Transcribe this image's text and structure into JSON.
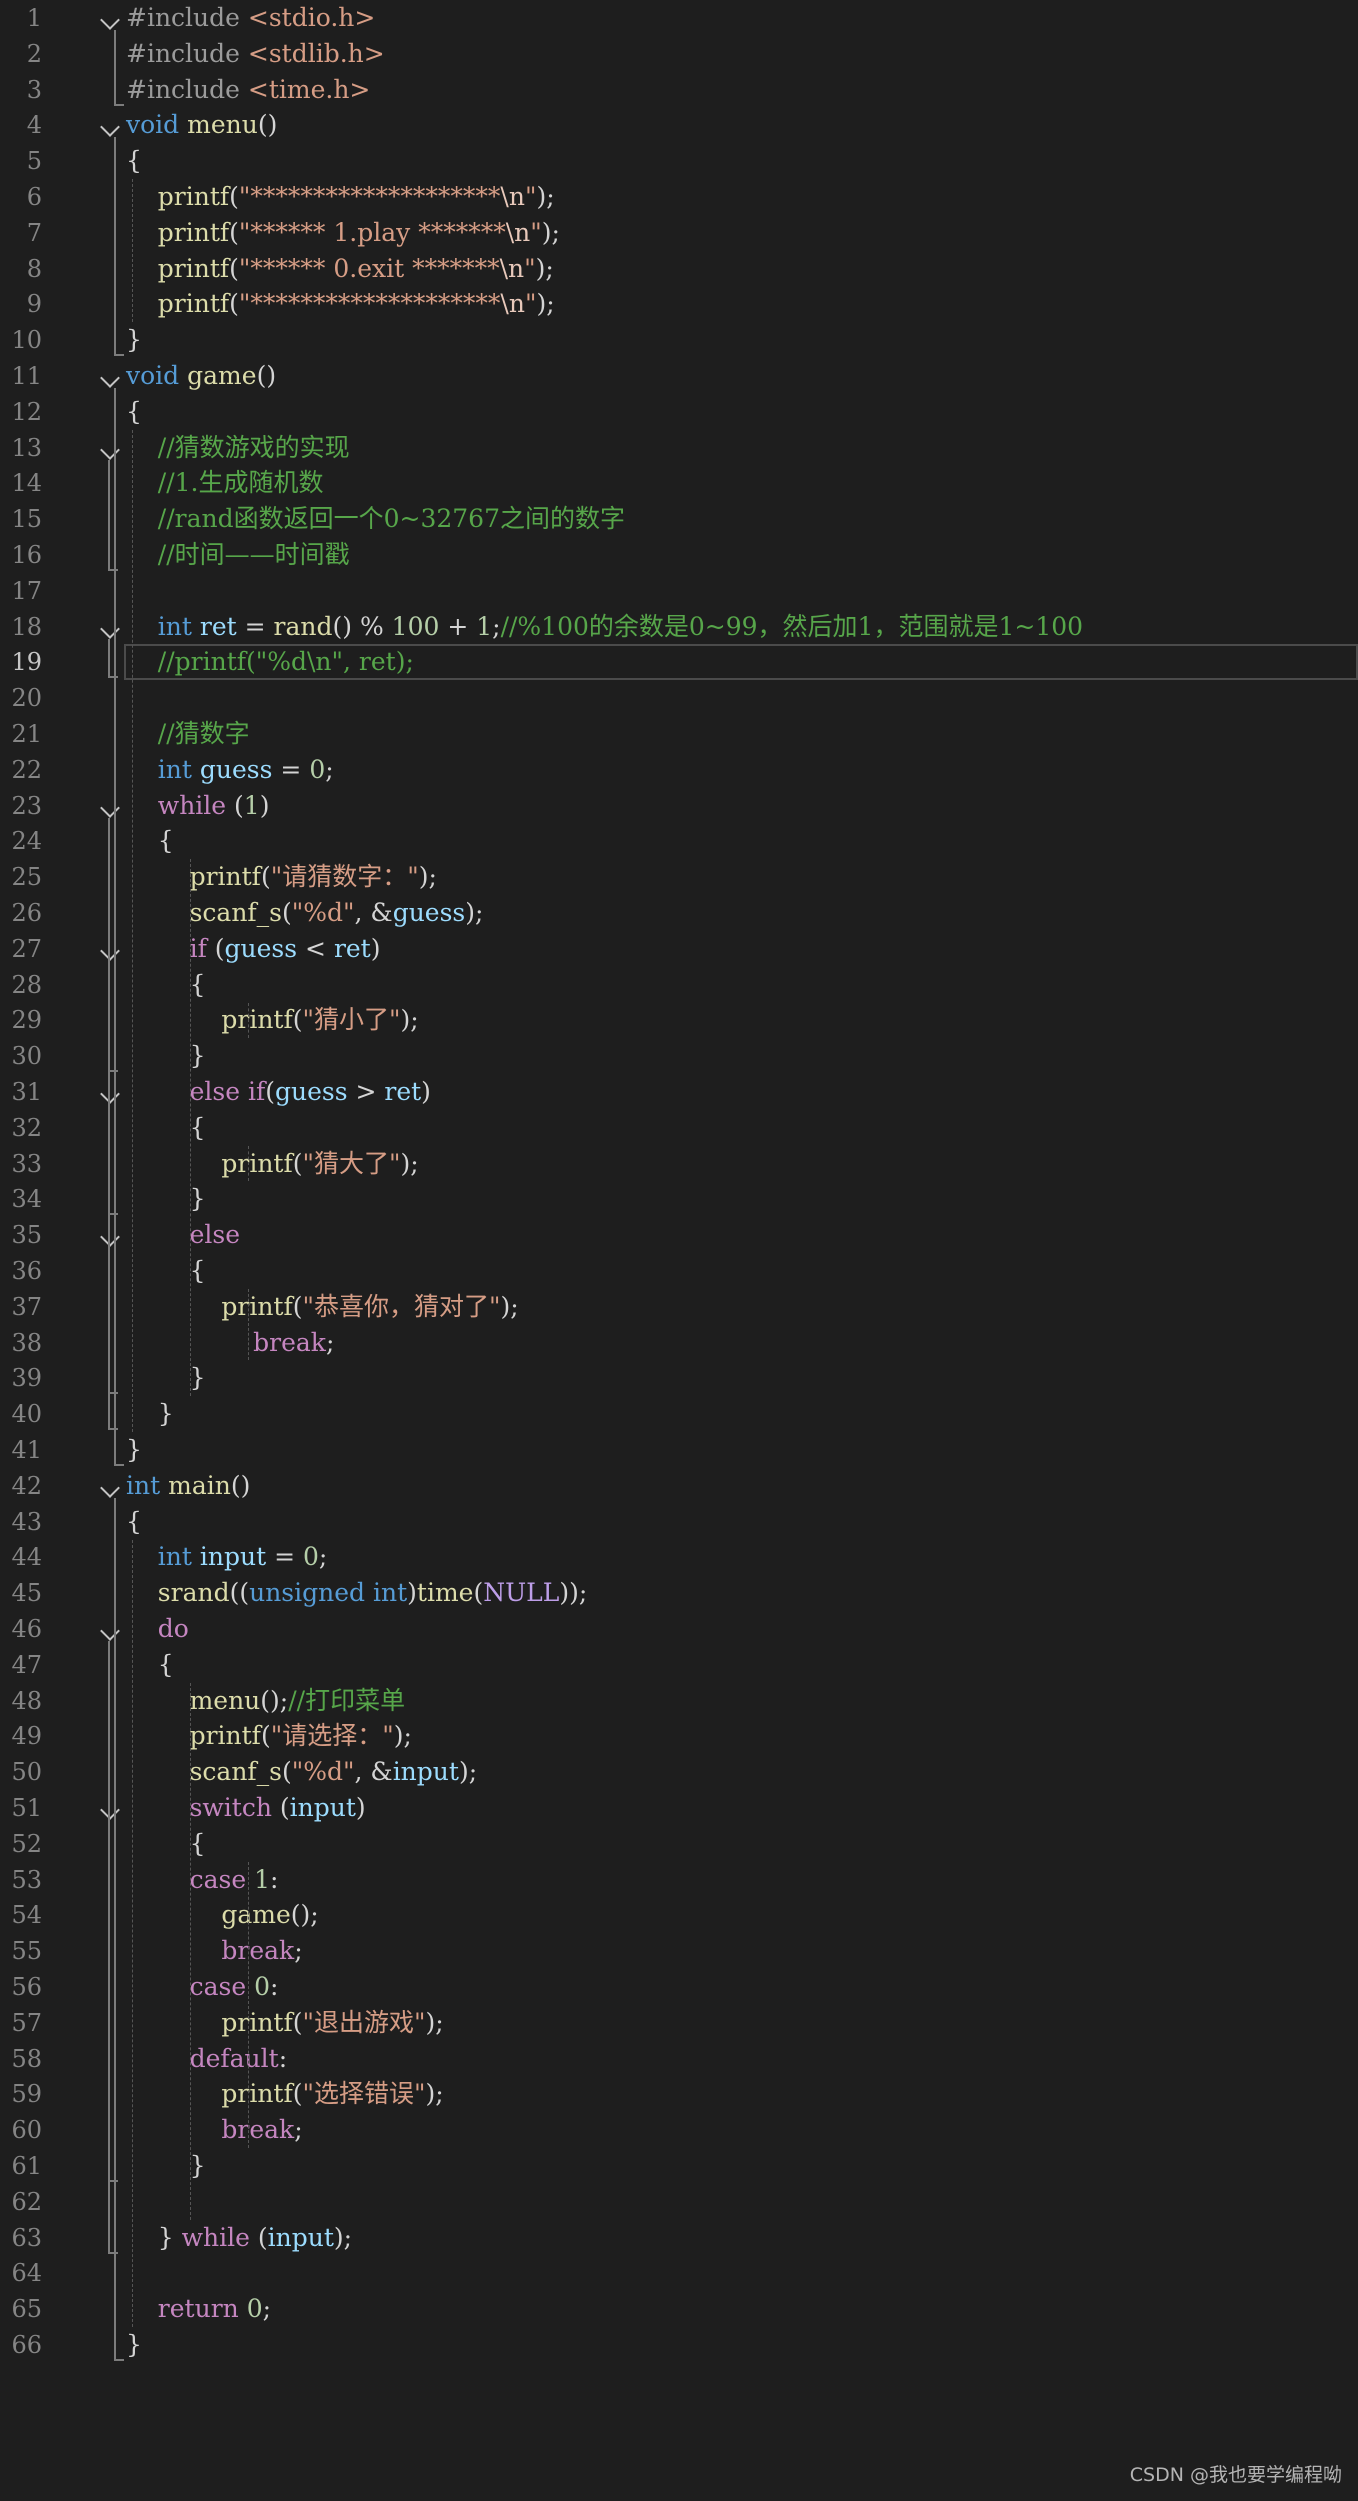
{
  "editor": {
    "current_line": 19,
    "folded_lines": [
      1,
      4,
      11,
      13,
      18,
      23,
      27,
      31,
      35,
      42,
      46,
      51
    ],
    "lines": [
      {
        "n": "1",
        "tokens": [
          [
            "pp",
            "#include "
          ],
          [
            "inc",
            "<stdio.h>"
          ]
        ]
      },
      {
        "n": "2",
        "tokens": [
          [
            "pp",
            "#include "
          ],
          [
            "inc",
            "<stdlib.h>"
          ]
        ]
      },
      {
        "n": "3",
        "tokens": [
          [
            "pp",
            "#include "
          ],
          [
            "inc",
            "<time.h>"
          ]
        ]
      },
      {
        "n": "4",
        "tokens": [
          [
            "kw",
            "void"
          ],
          [
            "pl",
            " "
          ],
          [
            "fn",
            "menu"
          ],
          [
            "pl",
            "()"
          ]
        ]
      },
      {
        "n": "5",
        "tokens": [
          [
            "pl",
            "{"
          ]
        ]
      },
      {
        "n": "6",
        "tokens": [
          [
            "pl",
            "    "
          ],
          [
            "fn",
            "printf"
          ],
          [
            "pl",
            "("
          ],
          [
            "str",
            "\"********************"
          ],
          [
            "esc",
            "\\n"
          ],
          [
            "str",
            "\""
          ],
          [
            "pl",
            ");"
          ]
        ]
      },
      {
        "n": "7",
        "tokens": [
          [
            "pl",
            "    "
          ],
          [
            "fn",
            "printf"
          ],
          [
            "pl",
            "("
          ],
          [
            "str",
            "\"****** 1.play *******"
          ],
          [
            "esc",
            "\\n"
          ],
          [
            "str",
            "\""
          ],
          [
            "pl",
            ");"
          ]
        ]
      },
      {
        "n": "8",
        "tokens": [
          [
            "pl",
            "    "
          ],
          [
            "fn",
            "printf"
          ],
          [
            "pl",
            "("
          ],
          [
            "str",
            "\"****** 0.exit *******"
          ],
          [
            "esc",
            "\\n"
          ],
          [
            "str",
            "\""
          ],
          [
            "pl",
            ");"
          ]
        ]
      },
      {
        "n": "9",
        "tokens": [
          [
            "pl",
            "    "
          ],
          [
            "fn",
            "printf"
          ],
          [
            "pl",
            "("
          ],
          [
            "str",
            "\"********************"
          ],
          [
            "esc",
            "\\n"
          ],
          [
            "str",
            "\""
          ],
          [
            "pl",
            ");"
          ]
        ]
      },
      {
        "n": "10",
        "tokens": [
          [
            "pl",
            "}"
          ]
        ]
      },
      {
        "n": "11",
        "tokens": [
          [
            "kw",
            "void"
          ],
          [
            "pl",
            " "
          ],
          [
            "fn",
            "game"
          ],
          [
            "pl",
            "()"
          ]
        ]
      },
      {
        "n": "12",
        "tokens": [
          [
            "pl",
            "{"
          ]
        ]
      },
      {
        "n": "13",
        "tokens": [
          [
            "pl",
            "    "
          ],
          [
            "com",
            "//猜数游戏的实现"
          ]
        ]
      },
      {
        "n": "14",
        "tokens": [
          [
            "pl",
            "    "
          ],
          [
            "com",
            "//1.生成随机数"
          ]
        ]
      },
      {
        "n": "15",
        "tokens": [
          [
            "pl",
            "    "
          ],
          [
            "com",
            "//rand函数返回一个0~32767之间的数字"
          ]
        ]
      },
      {
        "n": "16",
        "tokens": [
          [
            "pl",
            "    "
          ],
          [
            "com",
            "//时间——时间戳"
          ]
        ]
      },
      {
        "n": "17",
        "tokens": []
      },
      {
        "n": "18",
        "tokens": [
          [
            "pl",
            "    "
          ],
          [
            "kw",
            "int"
          ],
          [
            "pl",
            " "
          ],
          [
            "var",
            "ret"
          ],
          [
            "pl",
            " = "
          ],
          [
            "fn",
            "rand"
          ],
          [
            "pl",
            "() % "
          ],
          [
            "num",
            "100"
          ],
          [
            "pl",
            " + "
          ],
          [
            "num",
            "1"
          ],
          [
            "pl",
            ";"
          ],
          [
            "com",
            "//%100的余数是0~99，然后加1，范围就是1~100"
          ]
        ]
      },
      {
        "n": "19",
        "tokens": [
          [
            "pl",
            "    "
          ],
          [
            "com",
            "//printf(\"%d\\n\", ret);"
          ]
        ]
      },
      {
        "n": "20",
        "tokens": []
      },
      {
        "n": "21",
        "tokens": [
          [
            "pl",
            "    "
          ],
          [
            "com",
            "//猜数字"
          ]
        ]
      },
      {
        "n": "22",
        "tokens": [
          [
            "pl",
            "    "
          ],
          [
            "kw",
            "int"
          ],
          [
            "pl",
            " "
          ],
          [
            "var",
            "guess"
          ],
          [
            "pl",
            " = "
          ],
          [
            "num",
            "0"
          ],
          [
            "pl",
            ";"
          ]
        ]
      },
      {
        "n": "23",
        "tokens": [
          [
            "pl",
            "    "
          ],
          [
            "ctl",
            "while"
          ],
          [
            "pl",
            " ("
          ],
          [
            "num",
            "1"
          ],
          [
            "pl",
            ")"
          ]
        ]
      },
      {
        "n": "24",
        "tokens": [
          [
            "pl",
            "    {"
          ]
        ]
      },
      {
        "n": "25",
        "tokens": [
          [
            "pl",
            "        "
          ],
          [
            "fn",
            "printf"
          ],
          [
            "pl",
            "("
          ],
          [
            "str",
            "\"请猜数字：\""
          ],
          [
            "pl",
            ");"
          ]
        ]
      },
      {
        "n": "26",
        "tokens": [
          [
            "pl",
            "        "
          ],
          [
            "fn",
            "scanf_s"
          ],
          [
            "pl",
            "("
          ],
          [
            "str",
            "\"%d\""
          ],
          [
            "pl",
            ", &"
          ],
          [
            "var",
            "guess"
          ],
          [
            "pl",
            ");"
          ]
        ]
      },
      {
        "n": "27",
        "tokens": [
          [
            "pl",
            "        "
          ],
          [
            "ctl",
            "if"
          ],
          [
            "pl",
            " ("
          ],
          [
            "var",
            "guess"
          ],
          [
            "pl",
            " < "
          ],
          [
            "var",
            "ret"
          ],
          [
            "pl",
            ")"
          ]
        ]
      },
      {
        "n": "28",
        "tokens": [
          [
            "pl",
            "        {"
          ]
        ]
      },
      {
        "n": "29",
        "tokens": [
          [
            "pl",
            "            "
          ],
          [
            "fn",
            "printf"
          ],
          [
            "pl",
            "("
          ],
          [
            "str",
            "\"猜小了\""
          ],
          [
            "pl",
            ");"
          ]
        ]
      },
      {
        "n": "30",
        "tokens": [
          [
            "pl",
            "        }"
          ]
        ]
      },
      {
        "n": "31",
        "tokens": [
          [
            "pl",
            "        "
          ],
          [
            "ctl",
            "else"
          ],
          [
            "pl",
            " "
          ],
          [
            "ctl",
            "if"
          ],
          [
            "pl",
            "("
          ],
          [
            "var",
            "guess"
          ],
          [
            "pl",
            " > "
          ],
          [
            "var",
            "ret"
          ],
          [
            "pl",
            ")"
          ]
        ]
      },
      {
        "n": "32",
        "tokens": [
          [
            "pl",
            "        {"
          ]
        ]
      },
      {
        "n": "33",
        "tokens": [
          [
            "pl",
            "            "
          ],
          [
            "fn",
            "printf"
          ],
          [
            "pl",
            "("
          ],
          [
            "str",
            "\"猜大了\""
          ],
          [
            "pl",
            ");"
          ]
        ]
      },
      {
        "n": "34",
        "tokens": [
          [
            "pl",
            "        }"
          ]
        ]
      },
      {
        "n": "35",
        "tokens": [
          [
            "pl",
            "        "
          ],
          [
            "ctl",
            "else"
          ]
        ]
      },
      {
        "n": "36",
        "tokens": [
          [
            "pl",
            "        {"
          ]
        ]
      },
      {
        "n": "37",
        "tokens": [
          [
            "pl",
            "            "
          ],
          [
            "fn",
            "printf"
          ],
          [
            "pl",
            "("
          ],
          [
            "str",
            "\"恭喜你，猜对了\""
          ],
          [
            "pl",
            ");"
          ]
        ]
      },
      {
        "n": "38",
        "tokens": [
          [
            "pl",
            "                "
          ],
          [
            "ctl",
            "break"
          ],
          [
            "pl",
            ";"
          ]
        ]
      },
      {
        "n": "39",
        "tokens": [
          [
            "pl",
            "        }"
          ]
        ]
      },
      {
        "n": "40",
        "tokens": [
          [
            "pl",
            "    }"
          ]
        ]
      },
      {
        "n": "41",
        "tokens": [
          [
            "pl",
            "}"
          ]
        ]
      },
      {
        "n": "42",
        "tokens": [
          [
            "kw",
            "int"
          ],
          [
            "pl",
            " "
          ],
          [
            "fn",
            "main"
          ],
          [
            "pl",
            "()"
          ]
        ]
      },
      {
        "n": "43",
        "tokens": [
          [
            "pl",
            "{"
          ]
        ]
      },
      {
        "n": "44",
        "tokens": [
          [
            "pl",
            "    "
          ],
          [
            "kw",
            "int"
          ],
          [
            "pl",
            " "
          ],
          [
            "var",
            "input"
          ],
          [
            "pl",
            " = "
          ],
          [
            "num",
            "0"
          ],
          [
            "pl",
            ";"
          ]
        ]
      },
      {
        "n": "45",
        "tokens": [
          [
            "pl",
            "    "
          ],
          [
            "fn",
            "srand"
          ],
          [
            "pl",
            "(("
          ],
          [
            "kw",
            "unsigned"
          ],
          [
            "pl",
            " "
          ],
          [
            "kw",
            "int"
          ],
          [
            "pl",
            ")"
          ],
          [
            "fn",
            "time"
          ],
          [
            "pl",
            "("
          ],
          [
            "mac",
            "NULL"
          ],
          [
            "pl",
            "));"
          ]
        ]
      },
      {
        "n": "46",
        "tokens": [
          [
            "pl",
            "    "
          ],
          [
            "ctl",
            "do"
          ]
        ]
      },
      {
        "n": "47",
        "tokens": [
          [
            "pl",
            "    {"
          ]
        ]
      },
      {
        "n": "48",
        "tokens": [
          [
            "pl",
            "        "
          ],
          [
            "fn",
            "menu"
          ],
          [
            "pl",
            "();"
          ],
          [
            "com",
            "//打印菜单"
          ]
        ]
      },
      {
        "n": "49",
        "tokens": [
          [
            "pl",
            "        "
          ],
          [
            "fn",
            "printf"
          ],
          [
            "pl",
            "("
          ],
          [
            "str",
            "\"请选择：\""
          ],
          [
            "pl",
            ");"
          ]
        ]
      },
      {
        "n": "50",
        "tokens": [
          [
            "pl",
            "        "
          ],
          [
            "fn",
            "scanf_s"
          ],
          [
            "pl",
            "("
          ],
          [
            "str",
            "\"%d\""
          ],
          [
            "pl",
            ", &"
          ],
          [
            "var",
            "input"
          ],
          [
            "pl",
            ");"
          ]
        ]
      },
      {
        "n": "51",
        "tokens": [
          [
            "pl",
            "        "
          ],
          [
            "ctl",
            "switch"
          ],
          [
            "pl",
            " ("
          ],
          [
            "var",
            "input"
          ],
          [
            "pl",
            ")"
          ]
        ]
      },
      {
        "n": "52",
        "tokens": [
          [
            "pl",
            "        {"
          ]
        ]
      },
      {
        "n": "53",
        "tokens": [
          [
            "pl",
            "        "
          ],
          [
            "ctl",
            "case"
          ],
          [
            "pl",
            " "
          ],
          [
            "num",
            "1"
          ],
          [
            "pl",
            ":"
          ]
        ]
      },
      {
        "n": "54",
        "tokens": [
          [
            "pl",
            "            "
          ],
          [
            "fn",
            "game"
          ],
          [
            "pl",
            "();"
          ]
        ]
      },
      {
        "n": "55",
        "tokens": [
          [
            "pl",
            "            "
          ],
          [
            "ctl",
            "break"
          ],
          [
            "pl",
            ";"
          ]
        ]
      },
      {
        "n": "56",
        "tokens": [
          [
            "pl",
            "        "
          ],
          [
            "ctl",
            "case"
          ],
          [
            "pl",
            " "
          ],
          [
            "num",
            "0"
          ],
          [
            "pl",
            ":"
          ]
        ]
      },
      {
        "n": "57",
        "tokens": [
          [
            "pl",
            "            "
          ],
          [
            "fn",
            "printf"
          ],
          [
            "pl",
            "("
          ],
          [
            "str",
            "\"退出游戏\""
          ],
          [
            "pl",
            ");"
          ]
        ]
      },
      {
        "n": "58",
        "tokens": [
          [
            "pl",
            "        "
          ],
          [
            "ctl",
            "default"
          ],
          [
            "pl",
            ":"
          ]
        ]
      },
      {
        "n": "59",
        "tokens": [
          [
            "pl",
            "            "
          ],
          [
            "fn",
            "printf"
          ],
          [
            "pl",
            "("
          ],
          [
            "str",
            "\"选择错误\""
          ],
          [
            "pl",
            ");"
          ]
        ]
      },
      {
        "n": "60",
        "tokens": [
          [
            "pl",
            "            "
          ],
          [
            "ctl",
            "break"
          ],
          [
            "pl",
            ";"
          ]
        ]
      },
      {
        "n": "61",
        "tokens": [
          [
            "pl",
            "        }"
          ]
        ]
      },
      {
        "n": "62",
        "tokens": []
      },
      {
        "n": "63",
        "tokens": [
          [
            "pl",
            "    } "
          ],
          [
            "ctl",
            "while"
          ],
          [
            "pl",
            " ("
          ],
          [
            "var",
            "input"
          ],
          [
            "pl",
            ");"
          ]
        ]
      },
      {
        "n": "64",
        "tokens": []
      },
      {
        "n": "65",
        "tokens": [
          [
            "pl",
            "    "
          ],
          [
            "ctl",
            "return"
          ],
          [
            "pl",
            " "
          ],
          [
            "num",
            "0"
          ],
          [
            "pl",
            ";"
          ]
        ]
      },
      {
        "n": "66",
        "tokens": [
          [
            "pl",
            "}"
          ]
        ]
      }
    ]
  },
  "watermark": "CSDN @我也要学编程呦",
  "colors": {
    "background": "#1e1e1e",
    "keyword": "#569cd6",
    "control": "#c586c0",
    "function": "#dcdcaa",
    "string": "#d69d85",
    "comment": "#57a64a",
    "variable": "#9cdcfe",
    "number": "#b5cea8"
  }
}
